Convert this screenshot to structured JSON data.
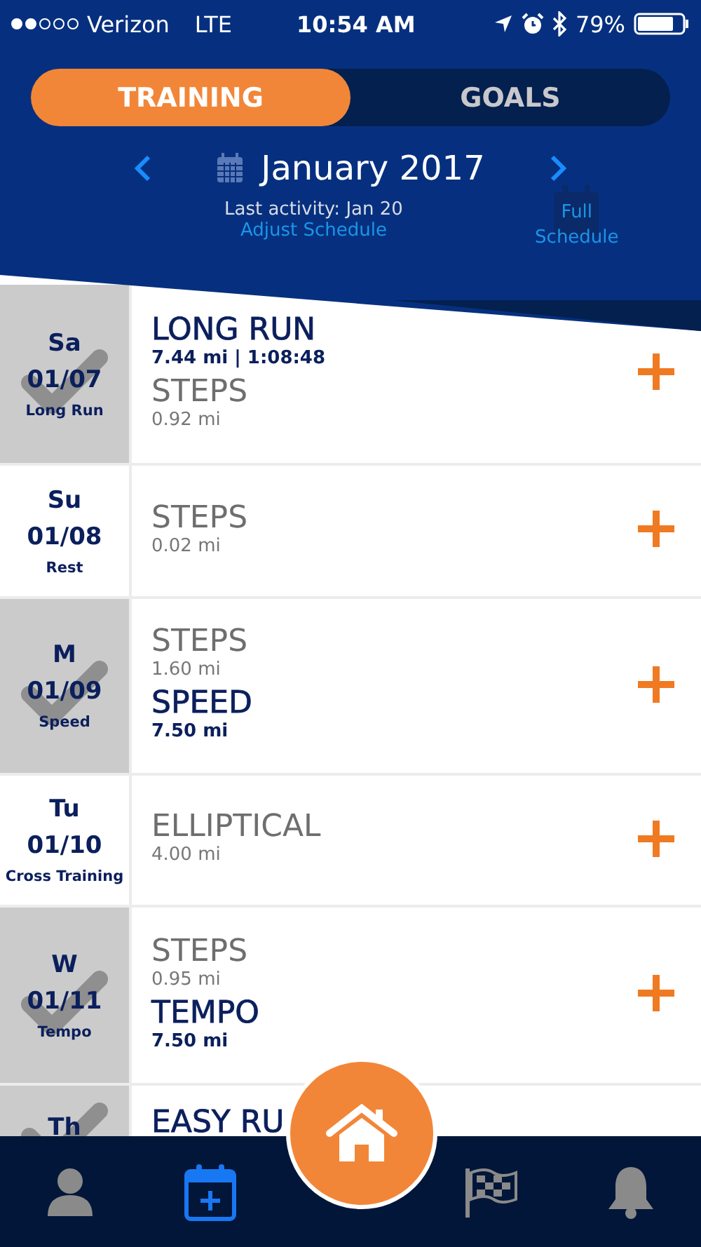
{
  "status_bar": {
    "carrier": "Verizon",
    "network": "LTE",
    "time": "10:54 AM",
    "battery": "79%"
  },
  "tabs": [
    {
      "label": "TRAINING",
      "selected": true
    },
    {
      "label": "GOALS",
      "selected": false
    }
  ],
  "month": {
    "title": "January 2017",
    "last_activity": "Last activity: Jan 20",
    "adjust_link": "Adjust Schedule",
    "full_schedule": "Full Schedule"
  },
  "days": [
    {
      "day": "Sa",
      "date": "01/07",
      "label": "Long Run",
      "checked": true,
      "activities": [
        {
          "kind": "primary",
          "name": "LONG RUN",
          "detail": "7.44 mi | 1:08:48"
        },
        {
          "kind": "secondary",
          "name": "STEPS",
          "detail": "0.92 mi"
        }
      ]
    },
    {
      "day": "Su",
      "date": "01/08",
      "label": "Rest",
      "checked": false,
      "activities": [
        {
          "kind": "secondary",
          "name": "STEPS",
          "detail": "0.02 mi"
        }
      ]
    },
    {
      "day": "M",
      "date": "01/09",
      "label": "Speed",
      "checked": true,
      "activities": [
        {
          "kind": "secondary",
          "name": "STEPS",
          "detail": "1.60 mi"
        },
        {
          "kind": "primary",
          "name": "SPEED",
          "detail": "7.50 mi"
        }
      ]
    },
    {
      "day": "Tu",
      "date": "01/10",
      "label": "Cross Training",
      "checked": false,
      "activities": [
        {
          "kind": "secondary",
          "name": "ELLIPTICAL",
          "detail": "4.00 mi"
        }
      ]
    },
    {
      "day": "W",
      "date": "01/11",
      "label": "Tempo",
      "checked": true,
      "activities": [
        {
          "kind": "secondary",
          "name": "STEPS",
          "detail": "0.95 mi"
        },
        {
          "kind": "primary",
          "name": "TEMPO",
          "detail": "7.50 mi"
        }
      ]
    },
    {
      "day": "Th",
      "checked": true,
      "activities": [
        {
          "kind": "primary",
          "name": "EASY RU"
        }
      ]
    }
  ],
  "nav": [
    {
      "kind": "profile",
      "selected": false
    },
    {
      "kind": "calendar",
      "selected": true
    },
    {
      "kind": "home",
      "selected": false
    },
    {
      "kind": "flag",
      "selected": false
    },
    {
      "kind": "bell",
      "selected": false
    }
  ]
}
